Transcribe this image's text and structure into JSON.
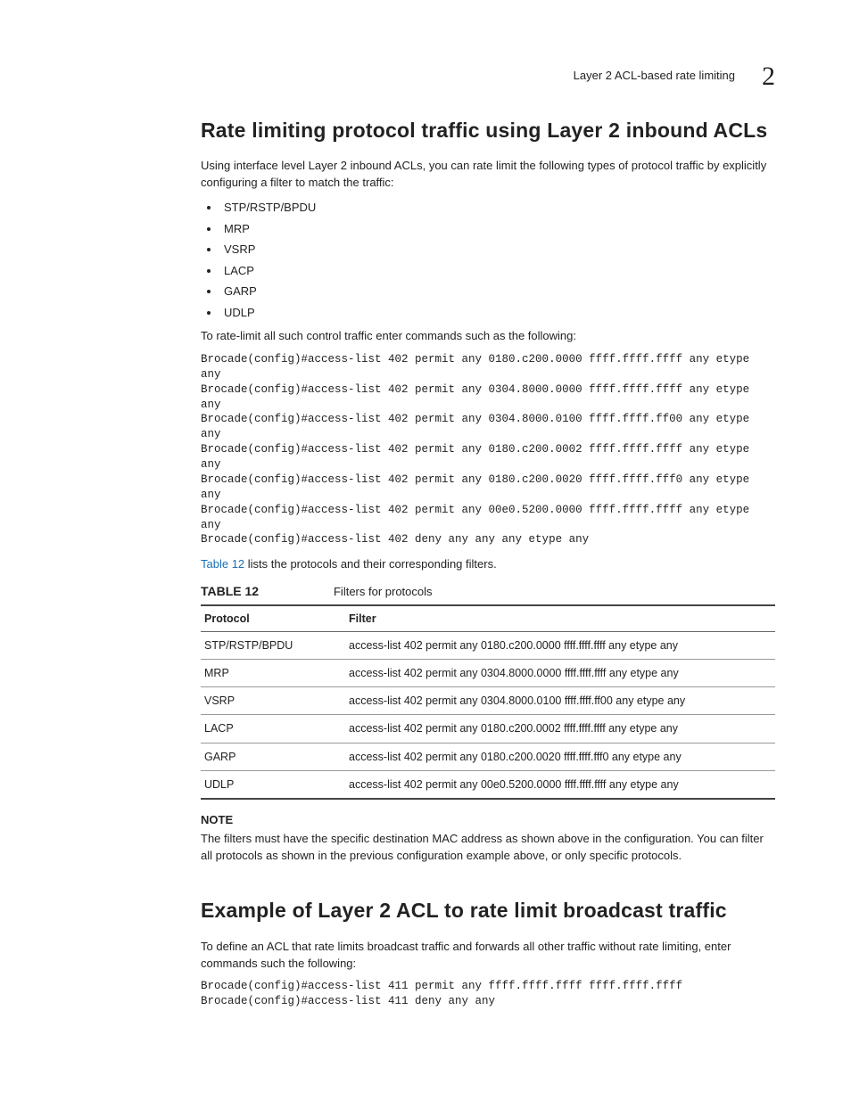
{
  "header": {
    "running_title": "Layer 2 ACL-based rate limiting",
    "chapter_number": "2"
  },
  "section1": {
    "heading": "Rate limiting protocol traffic using Layer 2 inbound ACLs",
    "intro": "Using interface level Layer 2 inbound ACLs, you can rate limit the following types of protocol traffic by explicitly configuring a filter to match the traffic:",
    "protocols": [
      "STP/RSTP/BPDU",
      "MRP",
      "VSRP",
      "LACP",
      "GARP",
      "UDLP"
    ],
    "cmd_intro": "To rate-limit all such control traffic enter commands such as the following:",
    "commands": "Brocade(config)#access-list 402 permit any 0180.c200.0000 ffff.ffff.ffff any etype any\nBrocade(config)#access-list 402 permit any 0304.8000.0000 ffff.ffff.ffff any etype any\nBrocade(config)#access-list 402 permit any 0304.8000.0100 ffff.ffff.ff00 any etype any\nBrocade(config)#access-list 402 permit any 0180.c200.0002 ffff.ffff.ffff any etype any\nBrocade(config)#access-list 402 permit any 0180.c200.0020 ffff.ffff.fff0 any etype any\nBrocade(config)#access-list 402 permit any 00e0.5200.0000 ffff.ffff.ffff any etype any\nBrocade(config)#access-list 402 deny any any any etype any",
    "table_ref_link": "Table 12",
    "table_ref_rest": " lists the protocols and their corresponding filters.",
    "table": {
      "label": "TABLE 12",
      "caption": "Filters for protocols",
      "col1": "Protocol",
      "col2": "Filter",
      "rows": [
        {
          "protocol": "STP/RSTP/BPDU",
          "filter": "access-list 402 permit any 0180.c200.0000 ffff.ffff.ffff any etype any"
        },
        {
          "protocol": "MRP",
          "filter": "access-list 402 permit any 0304.8000.0000 ffff.ffff.ffff any etype any"
        },
        {
          "protocol": "VSRP",
          "filter": "access-list 402 permit any 0304.8000.0100 ffff.ffff.ff00 any etype any"
        },
        {
          "protocol": "LACP",
          "filter": "access-list 402 permit any 0180.c200.0002 ffff.ffff.ffff any etype any"
        },
        {
          "protocol": "GARP",
          "filter": "access-list 402 permit any 0180.c200.0020 ffff.ffff.fff0 any etype any"
        },
        {
          "protocol": "UDLP",
          "filter": "access-list 402 permit any 00e0.5200.0000 ffff.ffff.ffff any etype any"
        }
      ]
    },
    "note_label": "NOTE",
    "note_body": "The filters must have the specific destination MAC address as shown above in the configuration. You can filter all protocols as shown in the previous configuration example above, or only specific protocols."
  },
  "section2": {
    "heading": "Example of Layer 2 ACL to rate limit broadcast traffic",
    "intro": "To define an ACL that rate limits broadcast traffic and forwards all other traffic without rate limiting, enter commands such the following:",
    "commands": "Brocade(config)#access-list 411 permit any ffff.ffff.ffff ffff.ffff.ffff \nBrocade(config)#access-list 411 deny any any"
  }
}
